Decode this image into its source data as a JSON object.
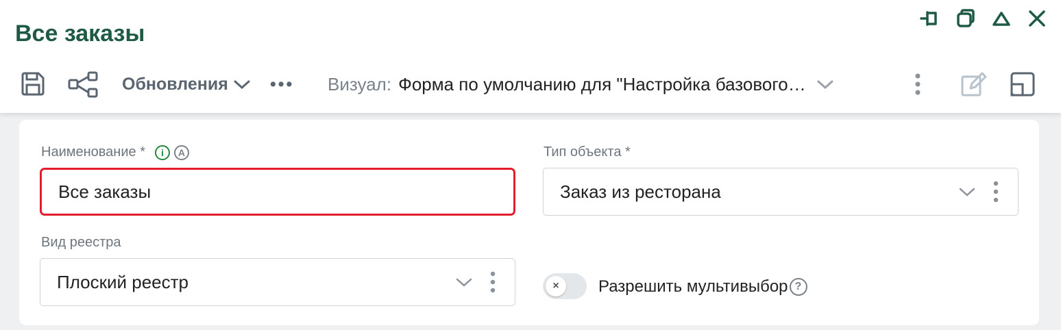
{
  "header": {
    "title": "Все заказы",
    "window_controls": [
      "pin-icon",
      "restore-icon",
      "collapse-icon",
      "close-icon"
    ]
  },
  "toolbar": {
    "save_icon": "save-icon",
    "share_icon": "share-icon",
    "updates_label": "Обновления",
    "more_label": "•••",
    "visual_label": "Визуал:",
    "visual_value": "Форма по умолчанию для \"Настройка базового…"
  },
  "form": {
    "name_label": "Наименование *",
    "name_value": "Все заказы",
    "name_info_icon": "info-icon",
    "name_auto_icon_text": "A",
    "object_type_label": "Тип объекта *",
    "object_type_value": "Заказ из ресторана",
    "registry_label": "Вид реестра",
    "registry_value": "Плоский реестр",
    "multiselect_label": "Разрешить мультивыбор",
    "multiselect_enabled": false
  },
  "colors": {
    "title": "#1f5a45",
    "accent_green": "#1e8a3a",
    "error_border": "#e31b2b"
  }
}
